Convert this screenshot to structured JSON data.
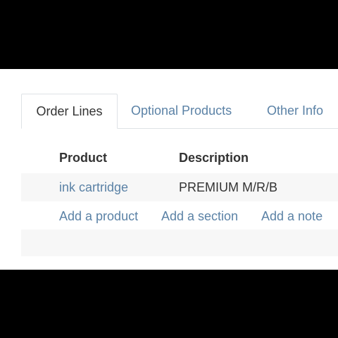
{
  "tabs": [
    {
      "label": "Order Lines",
      "active": true
    },
    {
      "label": "Optional Products",
      "active": false
    },
    {
      "label": "Other Info",
      "active": false
    }
  ],
  "table": {
    "columns": [
      "Product",
      "Description"
    ],
    "rows": [
      {
        "product": "ink cartridge",
        "description": "PREMIUM M/R/B"
      }
    ]
  },
  "actions": {
    "add_product": "Add a product",
    "add_section": "Add a section",
    "add_note": "Add a note"
  },
  "colors": {
    "link": "#5b82a6",
    "text": "#333333",
    "border": "#dee2e6",
    "row_background": "#f7f7f7"
  }
}
